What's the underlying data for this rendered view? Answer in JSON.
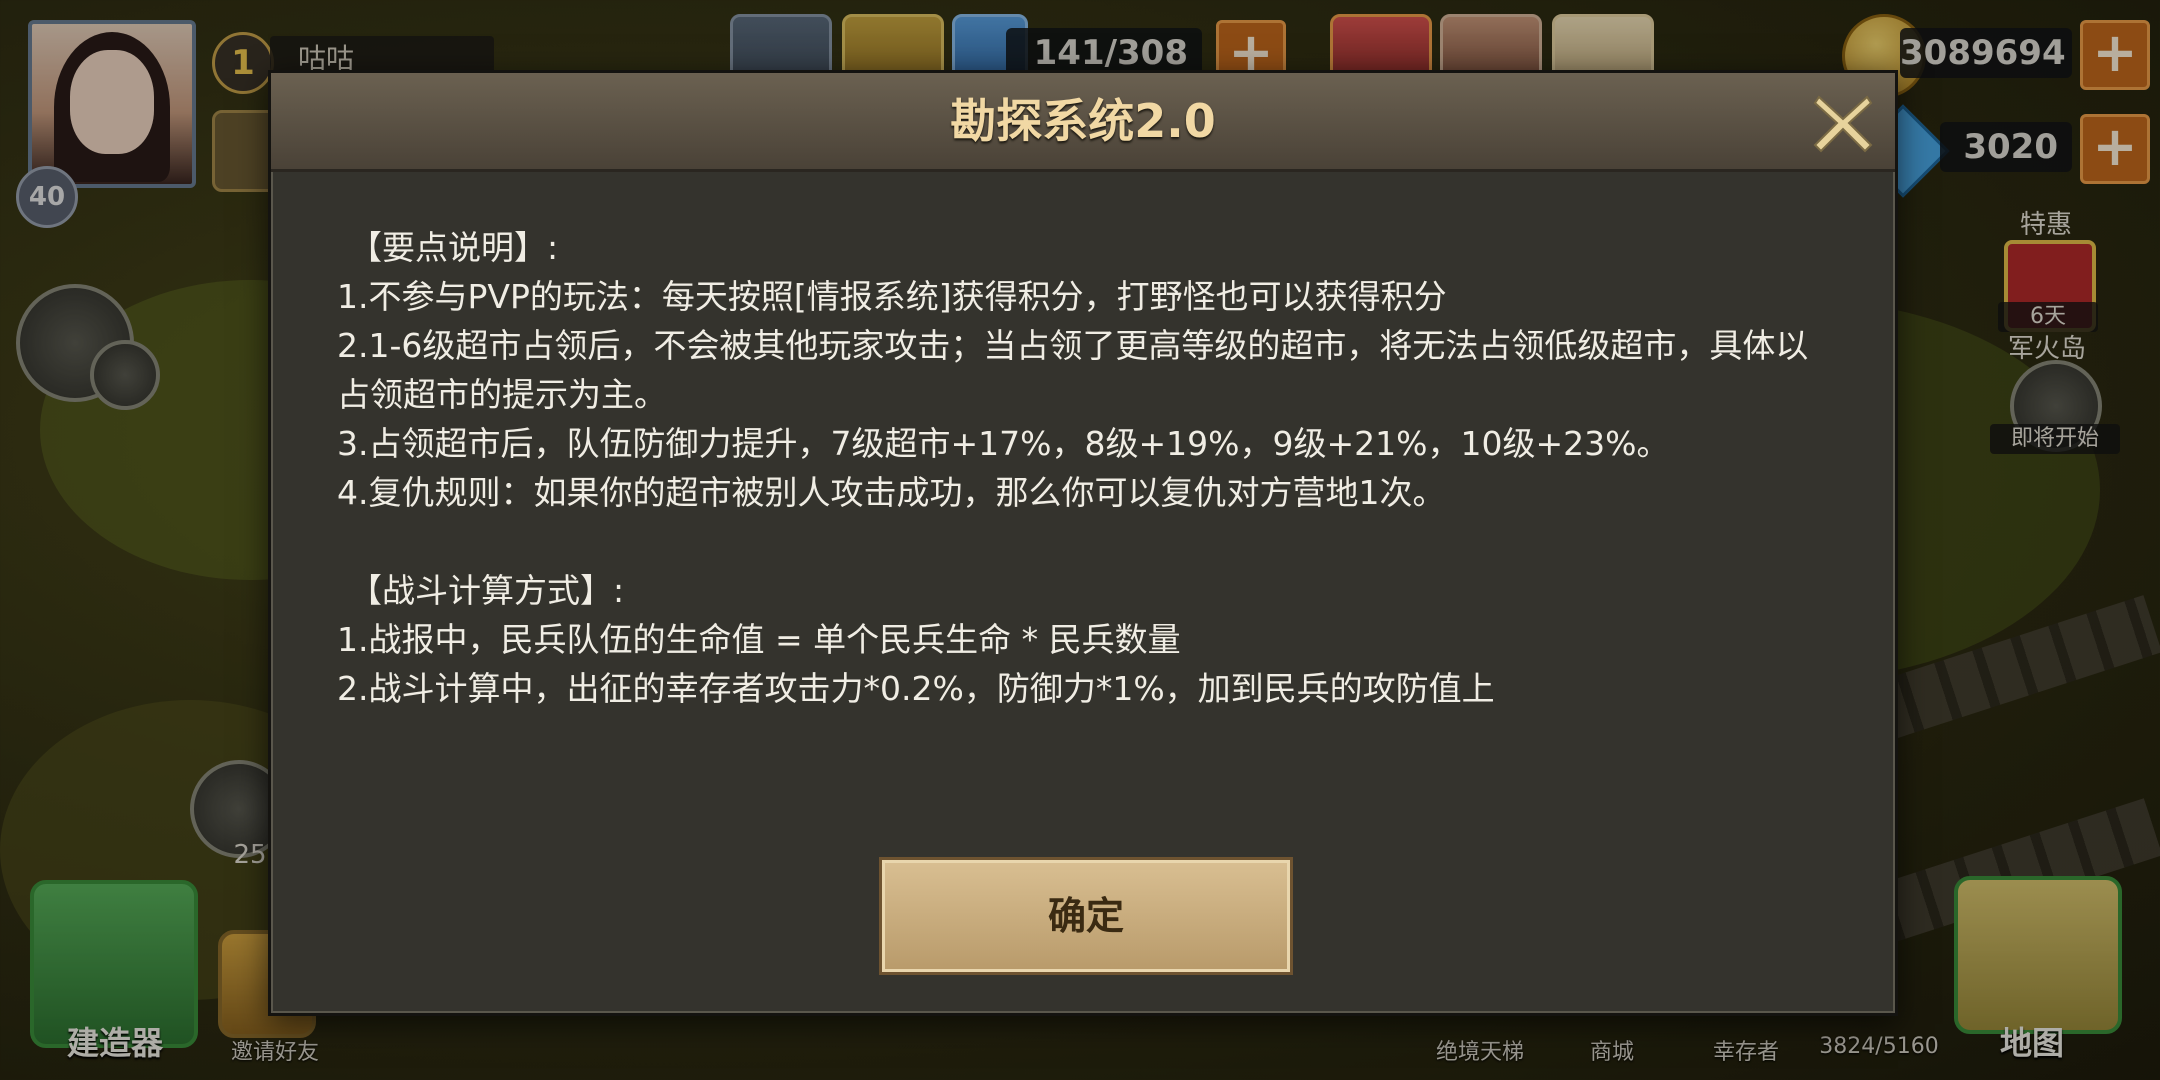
{
  "hud": {
    "player_level_num": "1",
    "player_name": "咕咕",
    "avatar_level": "40",
    "stamina": "141/308",
    "coins": "3089694",
    "gems": "3020"
  },
  "side": {
    "special_label": "特惠",
    "special_days": "6天",
    "event_name": "军火岛",
    "event_status": "即将开始",
    "left_count": "25"
  },
  "bottom": {
    "build_label": "建造器",
    "invite_label": "邀请好友",
    "ladder_label": "绝境天梯",
    "shop_label": "商城",
    "survivor_label": "幸存者",
    "capacity": "3824/5160",
    "map_label": "地图"
  },
  "dialog": {
    "title": "勘探系统2.0",
    "section1_heading": "【要点说明】:",
    "lines1": [
      "1.不参与PVP的玩法：每天按照[情报系统]获得积分，打野怪也可以获得积分",
      "2.1-6级超市占领后，不会被其他玩家攻击；当占领了更高等级的超市，将无法占领低级超市，具体以占领超市的提示为主。",
      "3.占领超市后，队伍防御力提升，7级超市+17%，8级+19%，9级+21%，10级+23%。",
      "4.复仇规则：如果你的超市被别人攻击成功，那么你可以复仇对方营地1次。"
    ],
    "section2_heading": "【战斗计算方式】:",
    "lines2": [
      "1.战报中，民兵队伍的生命值 = 单个民兵生命 * 民兵数量",
      "2.战斗计算中，出征的幸存者攻击力*0.2%，防御力*1%，加到民兵的攻防值上"
    ],
    "confirm_label": "确定"
  }
}
